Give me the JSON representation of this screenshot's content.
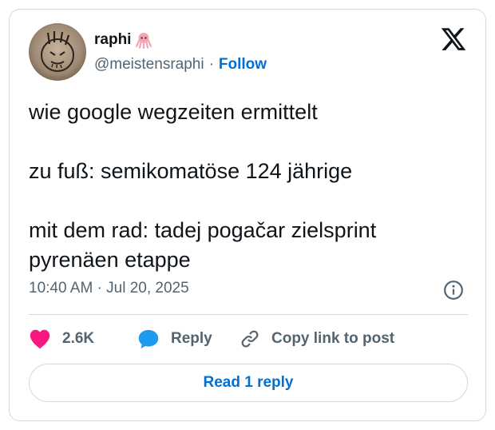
{
  "author": {
    "display_name": "raphi",
    "name_emoji": "octopus-emoji-icon",
    "handle": "@meistensraphi",
    "separator": "·",
    "follow_label": "Follow"
  },
  "brand": {
    "logo": "x-logo-icon"
  },
  "tweet": {
    "text": "wie google wegzeiten ermittelt\n\nzu fuß: semikomatöse 124 jährige\n\nmit dem rad: tadej pogačar zielsprint\npyrenäen etappe",
    "timestamp": "10:40 AM · Jul 20, 2025"
  },
  "actions": {
    "likes_count": "2.6K",
    "reply_label": "Reply",
    "copy_link_label": "Copy link to post"
  },
  "read_reply_label": "Read 1 reply",
  "colors": {
    "like": "#f91880",
    "reply_bubble": "#1d9bf0",
    "link": "#006fd6",
    "muted": "#536471",
    "border": "#cfd9de"
  }
}
